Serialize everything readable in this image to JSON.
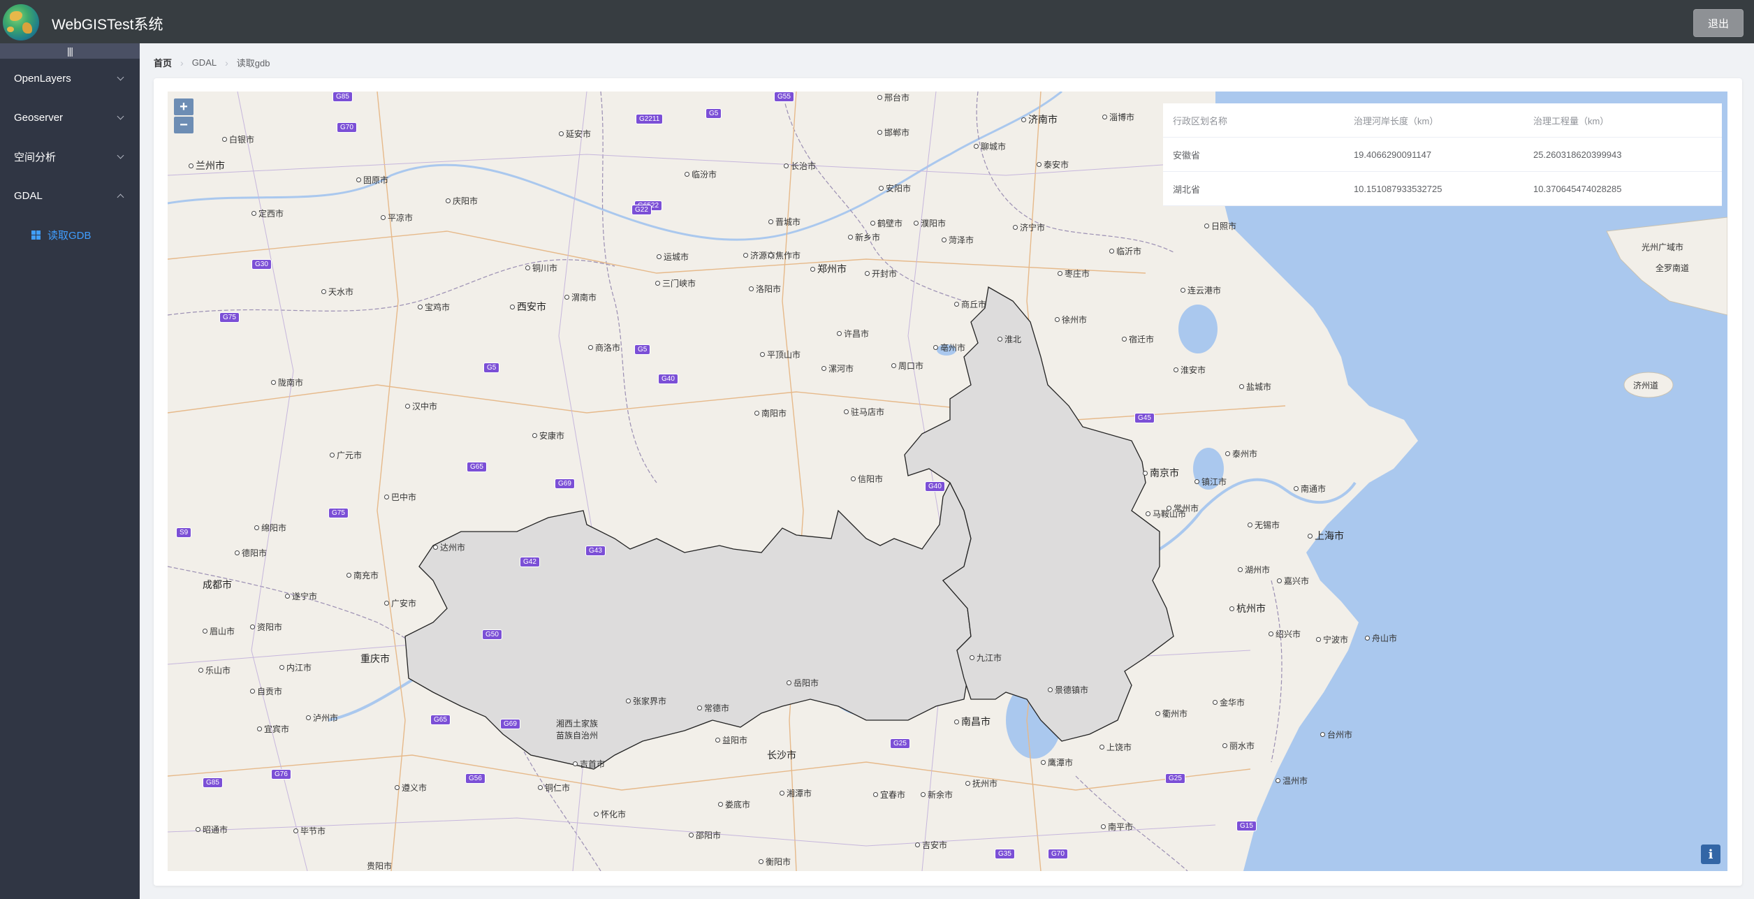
{
  "header": {
    "title": "WebGISTest系统",
    "logout_label": "退出"
  },
  "sidebar": {
    "collapse_glyph": "|||",
    "items": [
      {
        "label": "OpenLayers",
        "expanded": false
      },
      {
        "label": "Geoserver",
        "expanded": false
      },
      {
        "label": "空间分析",
        "expanded": false
      },
      {
        "label": "GDAL",
        "expanded": true
      }
    ],
    "active_sub_item": "读取GDB"
  },
  "breadcrumb": [
    "首页",
    "GDAL",
    "读取gdb"
  ],
  "map": {
    "zoom_in": "+",
    "zoom_out": "−",
    "info": "i",
    "places": [
      "兰州市",
      "白银市",
      "定西市",
      "固原市",
      "平凉市",
      "庆阳市",
      "延安市",
      "天水市",
      "宝鸡市",
      "铜川市",
      "西安市",
      "渭南市",
      "商洛市",
      "汉中市",
      "安康市",
      "陇南市",
      "广元市",
      "巴中市",
      "绵阳市",
      "德阳市",
      "达州市",
      "南充市",
      "成都市",
      "遂宁市",
      "广安市",
      "眉山市",
      "资阳市",
      "乐山市",
      "内江市",
      "重庆市",
      "自贡市",
      "泸州市",
      "宜宾市",
      "遵义市",
      "毕节市",
      "昭通市",
      "贵阳市",
      "铜仁市",
      "怀化市",
      "邵阳市",
      "娄底市",
      "衡阳市",
      "湘西土家族苗族自治州",
      "张家界市",
      "常德市",
      "益阳市",
      "岳阳市",
      "长沙市",
      "湘潭市",
      "吉首市",
      "临汾市",
      "长治市",
      "运城市",
      "晋城市",
      "济源市",
      "三门峡市",
      "洛阳市",
      "郑州市",
      "新乡市",
      "开封市",
      "焦作市",
      "许昌市",
      "平顶山市",
      "漯河市",
      "周口市",
      "南阳市",
      "驻马店市",
      "信阳市",
      "安阳市",
      "鹤壁市",
      "濮阳市",
      "邯郸市",
      "邢台市",
      "聊城市",
      "济南市",
      "淄博市",
      "泰安市",
      "菏泽市",
      "济宁市",
      "枣庄市",
      "临沂市",
      "日照市",
      "连云港市",
      "徐州市",
      "宿迁市",
      "商丘市",
      "亳州市",
      "淮北",
      "淮安市",
      "盐城市",
      "泰州市",
      "南京市",
      "镇江市",
      "常州市",
      "马鞍山市",
      "无锡市",
      "南通市",
      "上海市",
      "湖州市",
      "嘉兴市",
      "杭州市",
      "绍兴市",
      "宁波市",
      "舟山市",
      "金华市",
      "衢州市",
      "台州市",
      "丽水市",
      "温州市",
      "九江市",
      "景德镇市",
      "南昌市",
      "上饶市",
      "鹰潭市",
      "宜春市",
      "新余市",
      "抚州市",
      "吉安市",
      "南平市",
      "济州道",
      "光州广域市",
      "全罗南道"
    ],
    "highways": [
      "G70",
      "G2211",
      "G5",
      "G55",
      "G85",
      "G30",
      "G22",
      "G6522",
      "G75",
      "G5",
      "G40",
      "G65",
      "G69",
      "G75",
      "S9",
      "G42",
      "G43",
      "G50",
      "G40",
      "G45",
      "G65",
      "G69",
      "G56",
      "G76",
      "G25",
      "G15",
      "G85",
      "G35",
      "G70",
      "G25"
    ]
  },
  "table": {
    "headers": [
      "行政区划名称",
      "治理河岸长度（km）",
      "治理工程量（km）"
    ],
    "rows": [
      [
        "安徽省",
        "19.4066290091147",
        "25.260318620399943"
      ],
      [
        "湖北省",
        "10.151087933532725",
        "10.370645474028285"
      ]
    ]
  }
}
